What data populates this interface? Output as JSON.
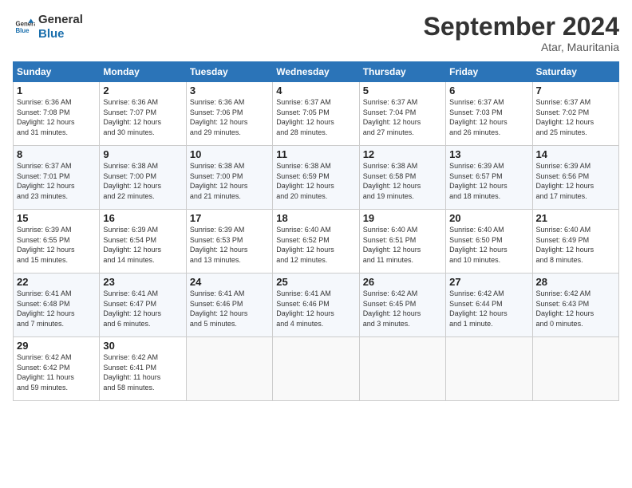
{
  "header": {
    "logo_line1": "General",
    "logo_line2": "Blue",
    "month_title": "September 2024",
    "location": "Atar, Mauritania"
  },
  "days_of_week": [
    "Sunday",
    "Monday",
    "Tuesday",
    "Wednesday",
    "Thursday",
    "Friday",
    "Saturday"
  ],
  "weeks": [
    [
      {
        "day": "1",
        "lines": [
          "Sunrise: 6:36 AM",
          "Sunset: 7:08 PM",
          "Daylight: 12 hours",
          "and 31 minutes."
        ]
      },
      {
        "day": "2",
        "lines": [
          "Sunrise: 6:36 AM",
          "Sunset: 7:07 PM",
          "Daylight: 12 hours",
          "and 30 minutes."
        ]
      },
      {
        "day": "3",
        "lines": [
          "Sunrise: 6:36 AM",
          "Sunset: 7:06 PM",
          "Daylight: 12 hours",
          "and 29 minutes."
        ]
      },
      {
        "day": "4",
        "lines": [
          "Sunrise: 6:37 AM",
          "Sunset: 7:05 PM",
          "Daylight: 12 hours",
          "and 28 minutes."
        ]
      },
      {
        "day": "5",
        "lines": [
          "Sunrise: 6:37 AM",
          "Sunset: 7:04 PM",
          "Daylight: 12 hours",
          "and 27 minutes."
        ]
      },
      {
        "day": "6",
        "lines": [
          "Sunrise: 6:37 AM",
          "Sunset: 7:03 PM",
          "Daylight: 12 hours",
          "and 26 minutes."
        ]
      },
      {
        "day": "7",
        "lines": [
          "Sunrise: 6:37 AM",
          "Sunset: 7:02 PM",
          "Daylight: 12 hours",
          "and 25 minutes."
        ]
      }
    ],
    [
      {
        "day": "8",
        "lines": [
          "Sunrise: 6:37 AM",
          "Sunset: 7:01 PM",
          "Daylight: 12 hours",
          "and 23 minutes."
        ]
      },
      {
        "day": "9",
        "lines": [
          "Sunrise: 6:38 AM",
          "Sunset: 7:00 PM",
          "Daylight: 12 hours",
          "and 22 minutes."
        ]
      },
      {
        "day": "10",
        "lines": [
          "Sunrise: 6:38 AM",
          "Sunset: 7:00 PM",
          "Daylight: 12 hours",
          "and 21 minutes."
        ]
      },
      {
        "day": "11",
        "lines": [
          "Sunrise: 6:38 AM",
          "Sunset: 6:59 PM",
          "Daylight: 12 hours",
          "and 20 minutes."
        ]
      },
      {
        "day": "12",
        "lines": [
          "Sunrise: 6:38 AM",
          "Sunset: 6:58 PM",
          "Daylight: 12 hours",
          "and 19 minutes."
        ]
      },
      {
        "day": "13",
        "lines": [
          "Sunrise: 6:39 AM",
          "Sunset: 6:57 PM",
          "Daylight: 12 hours",
          "and 18 minutes."
        ]
      },
      {
        "day": "14",
        "lines": [
          "Sunrise: 6:39 AM",
          "Sunset: 6:56 PM",
          "Daylight: 12 hours",
          "and 17 minutes."
        ]
      }
    ],
    [
      {
        "day": "15",
        "lines": [
          "Sunrise: 6:39 AM",
          "Sunset: 6:55 PM",
          "Daylight: 12 hours",
          "and 15 minutes."
        ]
      },
      {
        "day": "16",
        "lines": [
          "Sunrise: 6:39 AM",
          "Sunset: 6:54 PM",
          "Daylight: 12 hours",
          "and 14 minutes."
        ]
      },
      {
        "day": "17",
        "lines": [
          "Sunrise: 6:39 AM",
          "Sunset: 6:53 PM",
          "Daylight: 12 hours",
          "and 13 minutes."
        ]
      },
      {
        "day": "18",
        "lines": [
          "Sunrise: 6:40 AM",
          "Sunset: 6:52 PM",
          "Daylight: 12 hours",
          "and 12 minutes."
        ]
      },
      {
        "day": "19",
        "lines": [
          "Sunrise: 6:40 AM",
          "Sunset: 6:51 PM",
          "Daylight: 12 hours",
          "and 11 minutes."
        ]
      },
      {
        "day": "20",
        "lines": [
          "Sunrise: 6:40 AM",
          "Sunset: 6:50 PM",
          "Daylight: 12 hours",
          "and 10 minutes."
        ]
      },
      {
        "day": "21",
        "lines": [
          "Sunrise: 6:40 AM",
          "Sunset: 6:49 PM",
          "Daylight: 12 hours",
          "and 8 minutes."
        ]
      }
    ],
    [
      {
        "day": "22",
        "lines": [
          "Sunrise: 6:41 AM",
          "Sunset: 6:48 PM",
          "Daylight: 12 hours",
          "and 7 minutes."
        ]
      },
      {
        "day": "23",
        "lines": [
          "Sunrise: 6:41 AM",
          "Sunset: 6:47 PM",
          "Daylight: 12 hours",
          "and 6 minutes."
        ]
      },
      {
        "day": "24",
        "lines": [
          "Sunrise: 6:41 AM",
          "Sunset: 6:46 PM",
          "Daylight: 12 hours",
          "and 5 minutes."
        ]
      },
      {
        "day": "25",
        "lines": [
          "Sunrise: 6:41 AM",
          "Sunset: 6:46 PM",
          "Daylight: 12 hours",
          "and 4 minutes."
        ]
      },
      {
        "day": "26",
        "lines": [
          "Sunrise: 6:42 AM",
          "Sunset: 6:45 PM",
          "Daylight: 12 hours",
          "and 3 minutes."
        ]
      },
      {
        "day": "27",
        "lines": [
          "Sunrise: 6:42 AM",
          "Sunset: 6:44 PM",
          "Daylight: 12 hours",
          "and 1 minute."
        ]
      },
      {
        "day": "28",
        "lines": [
          "Sunrise: 6:42 AM",
          "Sunset: 6:43 PM",
          "Daylight: 12 hours",
          "and 0 minutes."
        ]
      }
    ],
    [
      {
        "day": "29",
        "lines": [
          "Sunrise: 6:42 AM",
          "Sunset: 6:42 PM",
          "Daylight: 11 hours",
          "and 59 minutes."
        ]
      },
      {
        "day": "30",
        "lines": [
          "Sunrise: 6:42 AM",
          "Sunset: 6:41 PM",
          "Daylight: 11 hours",
          "and 58 minutes."
        ]
      },
      {
        "day": "",
        "lines": []
      },
      {
        "day": "",
        "lines": []
      },
      {
        "day": "",
        "lines": []
      },
      {
        "day": "",
        "lines": []
      },
      {
        "day": "",
        "lines": []
      }
    ]
  ]
}
